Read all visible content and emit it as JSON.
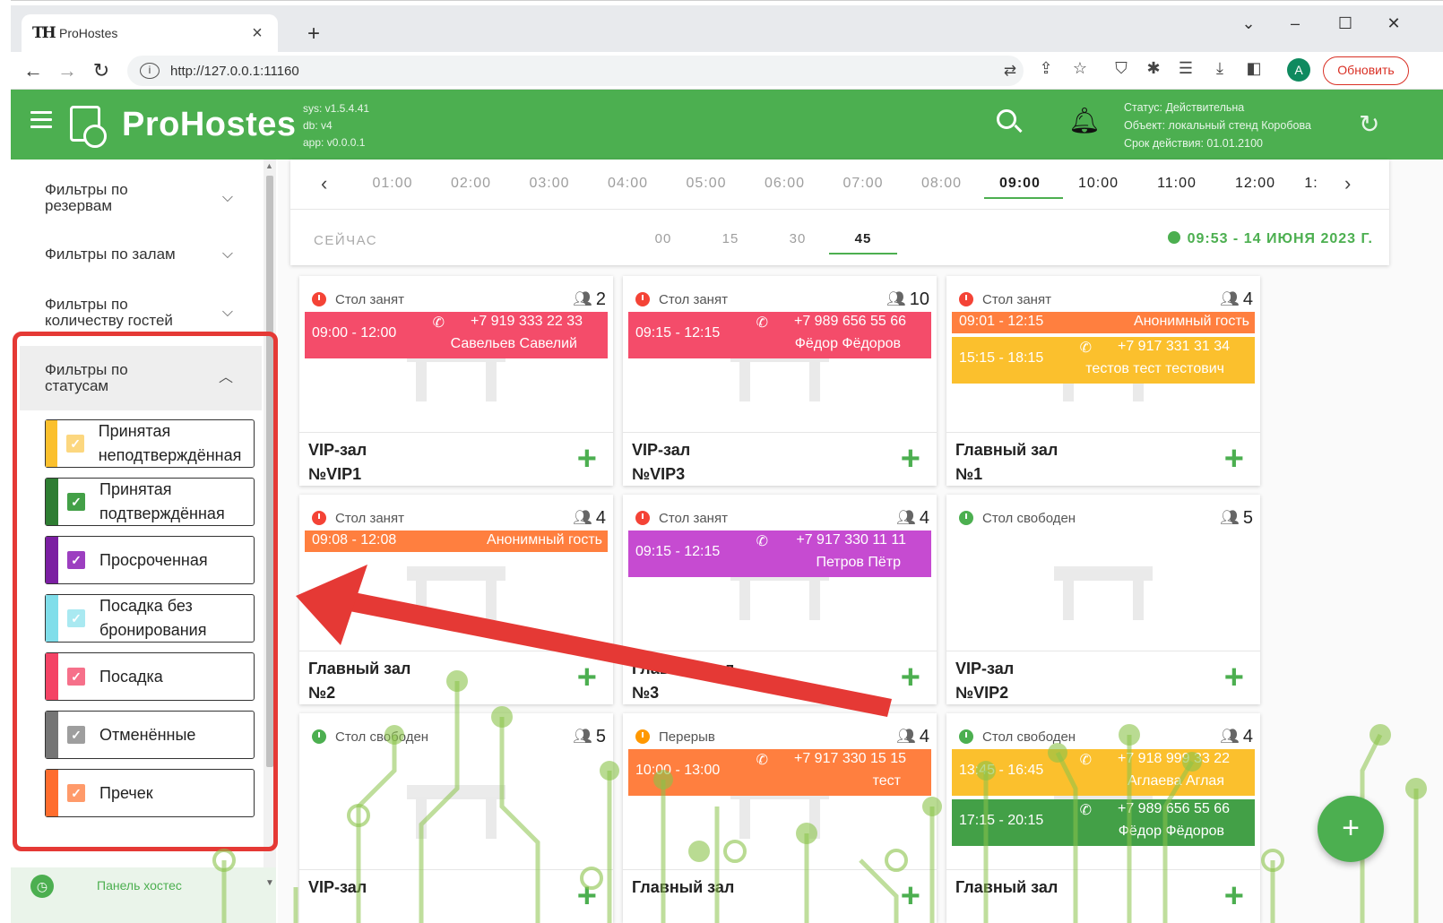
{
  "browser": {
    "tab_title": "ProHostes",
    "favicon_text": "TH",
    "url": "http://127.0.0.1:11160",
    "update_button": "Обновить",
    "avatar_letter": "A"
  },
  "header": {
    "brand": "ProHostes",
    "sys_version": "sys: v1.5.4.41",
    "db_version": "db: v4",
    "app_version": "app: v0.0.0.1",
    "status_line": "Статус: Действительна",
    "object_line": "Объект: локальный стенд Коробова",
    "valid_line": "Срок действия: 01.01.2100"
  },
  "sidebar": {
    "filters": [
      {
        "label": "Фильтры по резервам",
        "expanded": false
      },
      {
        "label": "Фильтры по залам",
        "expanded": false
      },
      {
        "label": "Фильтры по количеству гостей",
        "expanded": false
      },
      {
        "label": "Фильтры по статусам",
        "expanded": true
      }
    ],
    "statuses": [
      {
        "label": "Принятая неподтверждённая",
        "color": "#fbc02d",
        "checkbox": "#fcd77f"
      },
      {
        "label": "Принятая подтверждённая",
        "color": "#2e7d32",
        "checkbox": "#43a047"
      },
      {
        "label": "Просроченная",
        "color": "#7b1fa2",
        "checkbox": "#9c3fc0"
      },
      {
        "label": "Посадка без бронирования",
        "color": "#80deea",
        "checkbox": "#a9e9f1"
      },
      {
        "label": "Посадка",
        "color": "#f44365",
        "checkbox": "#f6708a"
      },
      {
        "label": "Отменённые",
        "color": "#757575",
        "checkbox": "#9e9e9e"
      },
      {
        "label": "Пречек",
        "color": "#ff6d2e",
        "checkbox": "#ff9a6a"
      }
    ],
    "footer_label": "Панель хостес"
  },
  "timeline": {
    "hours": [
      "01:00",
      "02:00",
      "03:00",
      "04:00",
      "05:00",
      "06:00",
      "07:00",
      "08:00",
      "09:00",
      "10:00",
      "11:00",
      "12:00",
      "1:"
    ],
    "active_hour": "09:00",
    "now_label": "СЕЙЧАС",
    "minutes": [
      "00",
      "15",
      "30",
      "45"
    ],
    "active_minute": "45",
    "current_datetime": "09:53 - 14 ИЮНЯ 2023 Г."
  },
  "cards": [
    {
      "status": "Стол занят",
      "status_color": "#f44336",
      "guests": "2",
      "hall": "VIP-зал",
      "number": "№VIP1",
      "bookings": [
        {
          "time": "09:00 - 12:00",
          "phone": "+7 919 333 22 33",
          "name": "Савельев Савелий",
          "color": "#f44c6a"
        }
      ]
    },
    {
      "status": "Стол занят",
      "status_color": "#f44336",
      "guests": "10",
      "hall": "VIP-зал",
      "number": "№VIP3",
      "bookings": [
        {
          "time": "09:15 - 12:15",
          "phone": "+7 989 656 55 66",
          "name": "Фёдор Фёдоров",
          "color": "#f44c6a"
        }
      ]
    },
    {
      "status": "Стол занят",
      "status_color": "#f44336",
      "guests": "4",
      "hall": "Главный зал",
      "number": "№1",
      "bookings": [
        {
          "time": "09:01 - 12:15",
          "anon": "Анонимный гость",
          "color": "#ff7f3f"
        },
        {
          "time": "15:15 - 18:15",
          "phone": "+7 917 331 31 34",
          "name": "тестов тест тестович",
          "color": "#fbc02d"
        }
      ]
    },
    {
      "status": "Стол занят",
      "status_color": "#f44336",
      "guests": "4",
      "hall": "Главный зал",
      "number": "№2",
      "bookings": [
        {
          "time": "09:08 - 12:08",
          "anon": "Анонимный гость",
          "color": "#ff7f3f"
        }
      ]
    },
    {
      "status": "Стол занят",
      "status_color": "#f44336",
      "guests": "4",
      "hall": "Главный зал",
      "number": "№3",
      "bookings": [
        {
          "time": "09:15 - 12:15",
          "phone": "+7 917 330 11 11",
          "name": "Петров Пётр",
          "color": "#c64bd1"
        }
      ]
    },
    {
      "status": "Стол свободен",
      "status_color": "#4caf50",
      "guests": "5",
      "hall": "VIP-зал",
      "number": "№VIP2",
      "bookings": []
    },
    {
      "status": "Стол свободен",
      "status_color": "#4caf50",
      "guests": "5",
      "hall": "VIP-зал",
      "number": "",
      "bookings": []
    },
    {
      "status": "Перерыв",
      "status_color": "#ff9800",
      "guests": "4",
      "hall": "Главный зал",
      "number": "",
      "bookings": [
        {
          "time": "10:00 - 13:00",
          "phone": "+7 917 330 15 15",
          "name": "тест",
          "color": "#ff7f3f"
        }
      ]
    },
    {
      "status": "Стол свободен",
      "status_color": "#4caf50",
      "guests": "4",
      "hall": "Главный зал",
      "number": "",
      "bookings": [
        {
          "time": "13:45 - 16:45",
          "phone": "+7 918 999 33 22",
          "name": "Аглаева Аглая",
          "color": "#fbc02d"
        },
        {
          "time": "17:15 - 20:15",
          "phone": "+7 989 656 55 66",
          "name": "Фёдор Фёдоров",
          "color": "#43a047"
        }
      ]
    }
  ]
}
